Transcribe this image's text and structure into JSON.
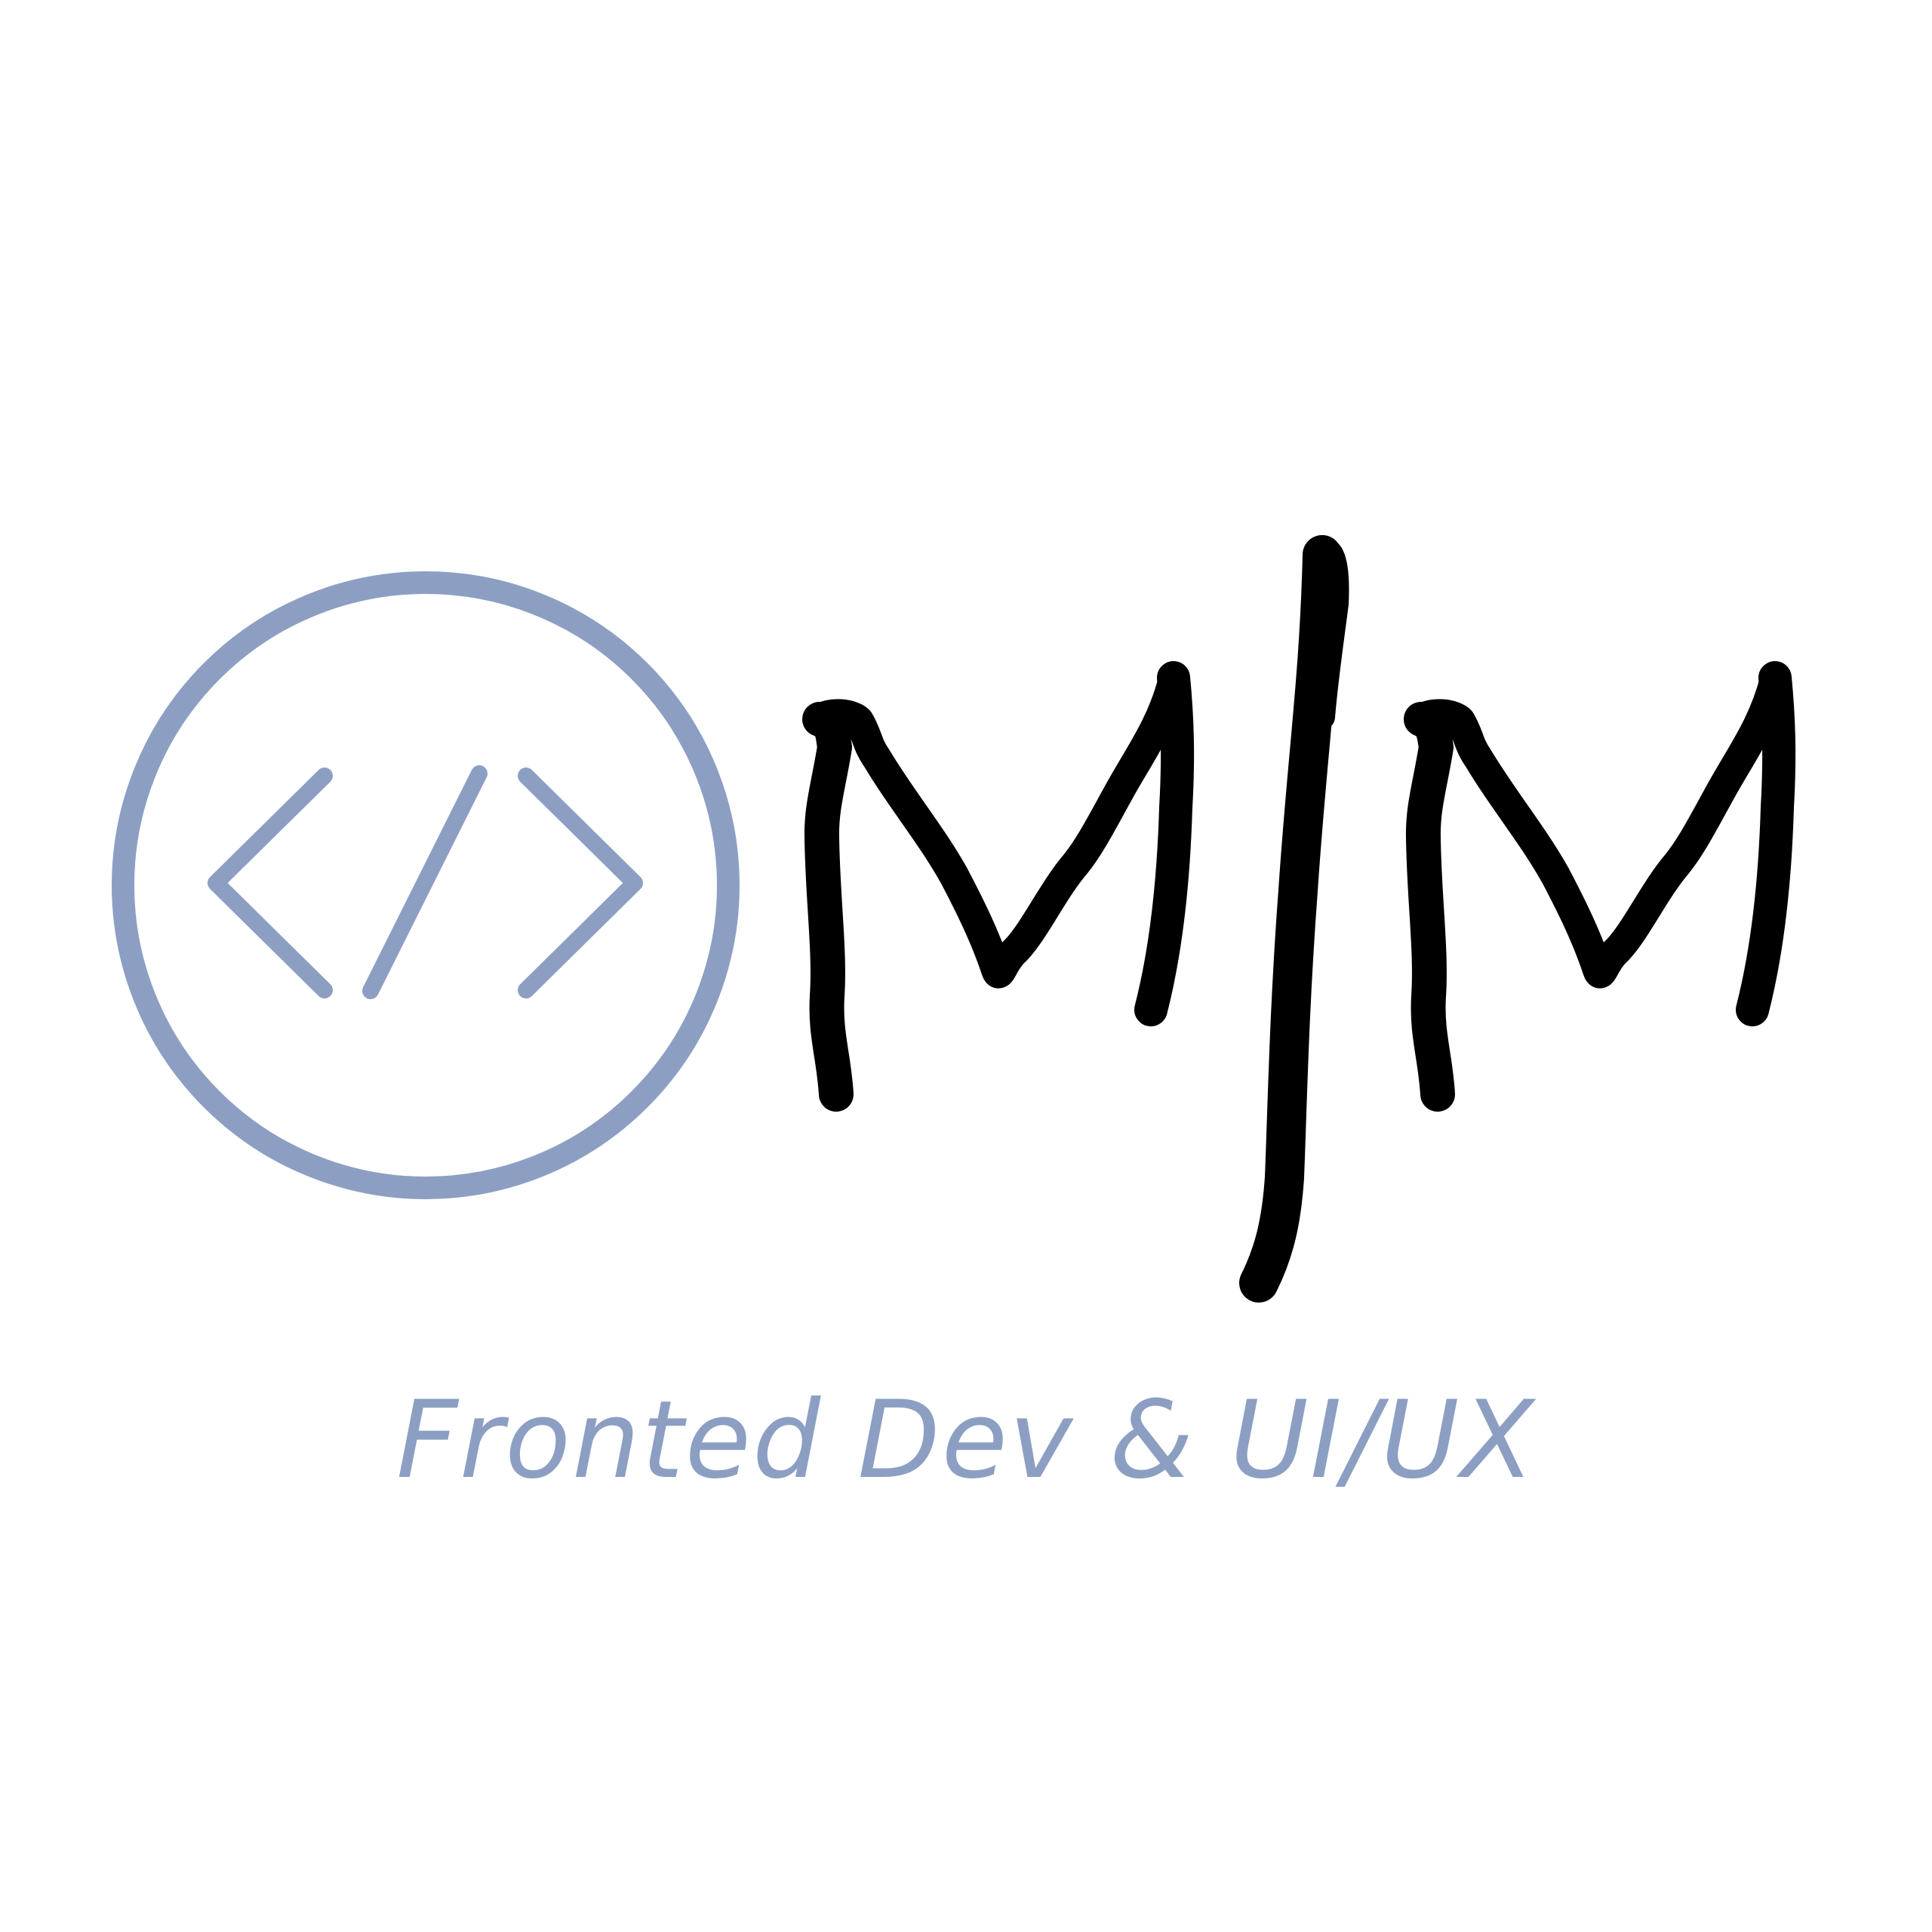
{
  "brand": {
    "monogram": "M|M",
    "code_symbol": "</>",
    "tagline": "Fronted Dev & UI/UX"
  },
  "colors": {
    "accent": "#8c9fc3",
    "ink": "#000000",
    "background": "#ffffff"
  },
  "icons": {
    "emblem": "code-brackets-icon"
  }
}
